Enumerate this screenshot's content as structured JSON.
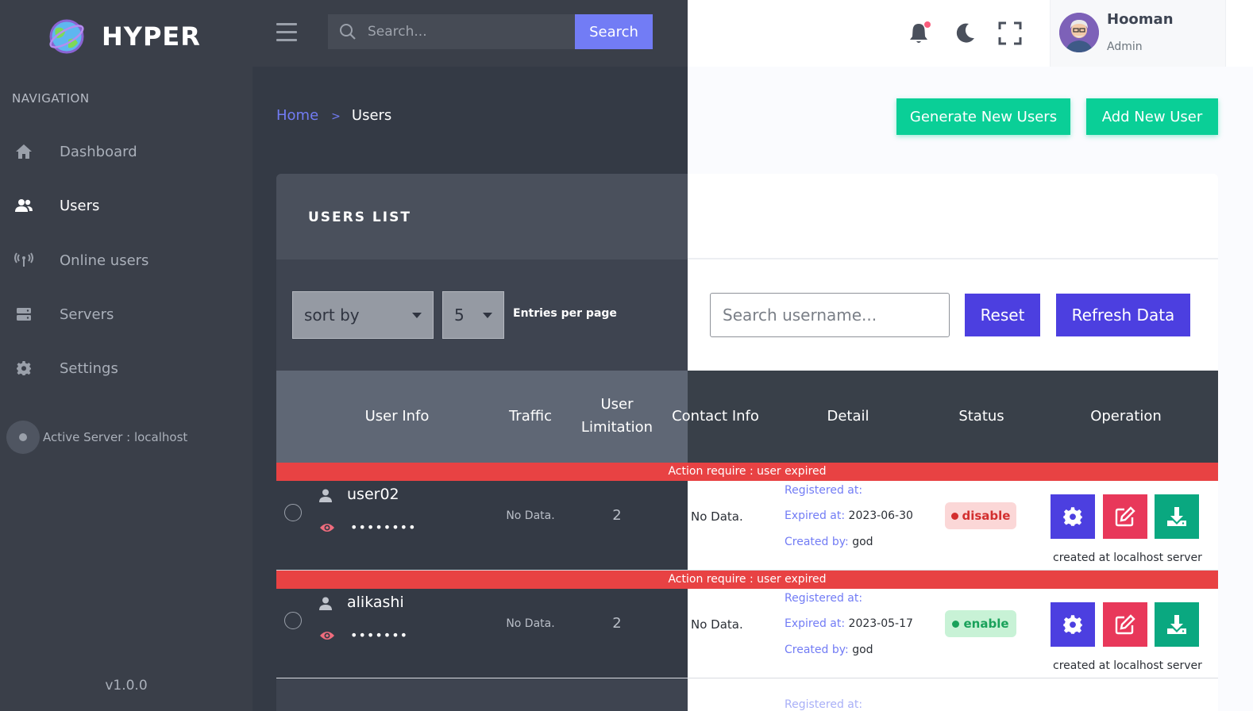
{
  "brand": {
    "name": "HYPER"
  },
  "sidebar": {
    "heading": "NAVIGATION",
    "items": [
      {
        "label": "Dashboard",
        "icon": "home-icon"
      },
      {
        "label": "Users",
        "icon": "users-icon"
      },
      {
        "label": "Online users",
        "icon": "broadcast-icon"
      },
      {
        "label": "Servers",
        "icon": "server-icon"
      },
      {
        "label": "Settings",
        "icon": "gear-icon"
      }
    ],
    "active_server": "Active Server : localhost",
    "version": "v1.0.0"
  },
  "topbar": {
    "search_placeholder": "Search...",
    "search_button": "Search",
    "user": {
      "name": "Hooman",
      "role": "Admin"
    }
  },
  "breadcrumb": {
    "home": "Home",
    "separator": ">",
    "current": "Users"
  },
  "actions": {
    "generate": "Generate New Users",
    "add": "Add New User"
  },
  "card": {
    "title": "USERS LIST",
    "sort_label": "sort by",
    "entries_value": "5",
    "entries_label": "Entries per page",
    "search_placeholder": "Search username...",
    "reset": "Reset",
    "refresh": "Refresh Data"
  },
  "table": {
    "headers": {
      "user_info": "User Info",
      "traffic": "Traffic",
      "limit_1": "User",
      "limit_2": "Limitation",
      "contact": "Contact Info",
      "detail": "Detail",
      "status": "Status",
      "operation": "Operation"
    },
    "rows": [
      {
        "alert": "Action require : user expired",
        "username": "user02",
        "password": "••••••••",
        "traffic": "No Data.",
        "limit": "2",
        "contact": "No Data.",
        "registered_label": "Registered at:",
        "expired_label": "Expired at:",
        "expired": "2023-06-30",
        "created_label": "Created by:",
        "created": "god",
        "status": "disable",
        "note": "created at localhost server"
      },
      {
        "alert": "Action require : user expired",
        "username": "alikashi",
        "password": "•••••••",
        "traffic": "No Data.",
        "limit": "2",
        "contact": "No Data.",
        "registered_label": "Registered at:",
        "expired_label": "Expired at:",
        "expired": "2023-05-17",
        "created_label": "Created by:",
        "created": "god",
        "status": "enable",
        "note": "created at localhost server"
      }
    ],
    "next_row_partial": "Registered at:"
  },
  "colors": {
    "primary": "#727cf5",
    "indigo": "#4c3fe0",
    "success": "#0acf97",
    "danger": "#e84243",
    "sidebar": "#3a3f49"
  }
}
